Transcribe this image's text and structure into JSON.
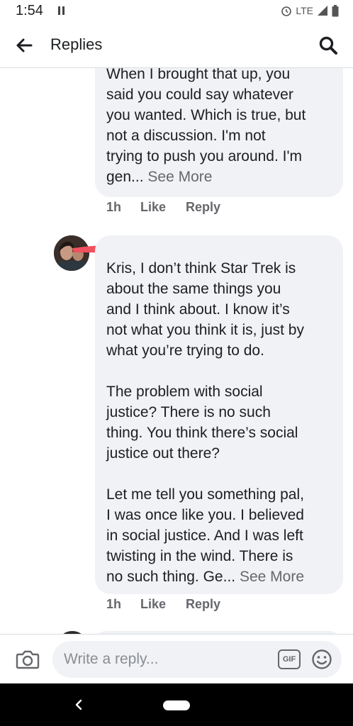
{
  "status_bar": {
    "time": "1:54",
    "network": "LTE"
  },
  "app_bar": {
    "title": "Replies",
    "back_icon": "arrow-left-icon",
    "search_icon": "search-icon"
  },
  "comments": [
    {
      "lines": [
        "When I brought that up, you",
        "said you could say whatever",
        "you wanted. Which is true, but",
        "not a discussion. I'm not",
        "trying to push you around. I'm"
      ],
      "last_line": "gen...",
      "see_more": "See More",
      "time": "1h",
      "like": "Like",
      "reply": "Reply"
    },
    {
      "paragraphs": [
        "Kris,   I don’t think Star Trek is\nabout the same things you\nand I think about. I know it’s\nnot what you think it is, just by\nwhat you’re trying to do.",
        "The problem with social\njustice? There is no such\nthing. You think there’s social\njustice out there?"
      ],
      "last_paragraph_lines": [
        "Let me tell you something pal,",
        "I was once like you. I believed",
        "in social justice. And I was left",
        "twisting in the wind. There is"
      ],
      "last_line": "no such thing. Ge...",
      "see_more": "See More",
      "time": "1h",
      "like": "Like",
      "reply": "Reply"
    }
  ],
  "composer": {
    "placeholder": "Write a reply...",
    "gif_label": "GIF",
    "camera_icon": "camera-icon",
    "emoji_icon": "smiley-icon"
  },
  "colors": {
    "bubble_bg": "#f0f2f5",
    "secondary_text": "#65676b",
    "redaction": "#f0515e"
  }
}
